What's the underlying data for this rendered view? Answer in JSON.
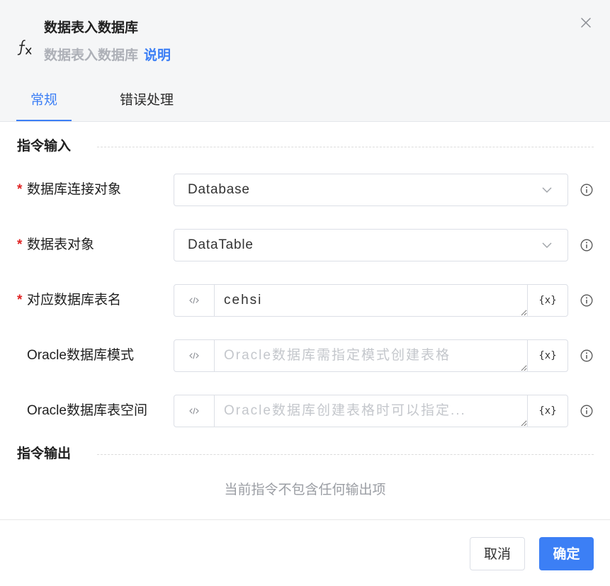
{
  "dialog": {
    "title": "数据表入数据库",
    "subtitle": "数据表入数据库",
    "help_link": "说明"
  },
  "tabs": [
    {
      "label": "常规",
      "active": true
    },
    {
      "label": "错误处理",
      "active": false
    }
  ],
  "form": {
    "required_mark": "*",
    "variable_button_label": "{x}"
  },
  "input_section": {
    "title": "指令输入"
  },
  "fields": [
    {
      "label": "数据库连接对象",
      "required": true,
      "type": "select",
      "value": "Database"
    },
    {
      "label": "数据表对象",
      "required": true,
      "type": "select",
      "value": "DataTable"
    },
    {
      "label": "对应数据库表名",
      "required": true,
      "type": "expression",
      "value": "cehsi"
    },
    {
      "label": "Oracle数据库模式",
      "required": false,
      "type": "expression",
      "value": "",
      "placeholder": "Oracle数据库需指定模式创建表格"
    },
    {
      "label": "Oracle数据库表空间",
      "required": false,
      "type": "expression",
      "value": "",
      "placeholder": "Oracle数据库创建表格时可以指定..."
    }
  ],
  "output_section": {
    "title": "指令输出",
    "empty_text": "当前指令不包含任何输出项"
  },
  "footer": {
    "cancel_label": "取消",
    "confirm_label": "确定"
  },
  "icons": {
    "header": "fx-icon",
    "close": "close-icon",
    "select": "chevron-down-icon",
    "expression_mode": "code-icon",
    "info": "info-icon"
  },
  "colors": {
    "accent": "#3c7ff5",
    "required": "#e02424",
    "header_bg": "#f5f6f7"
  }
}
